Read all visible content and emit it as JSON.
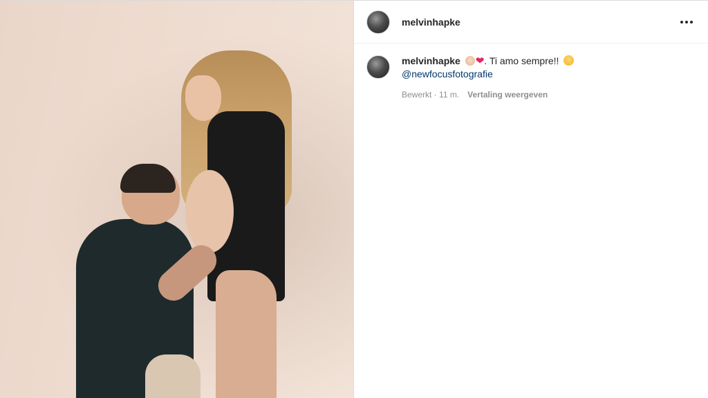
{
  "post": {
    "author": {
      "username": "melvinhapke"
    },
    "media": {
      "icon": "photo-image"
    },
    "caption": {
      "username": "melvinhapke",
      "emoji_baby": "👶🏼",
      "emoji_heart": "❤️",
      "text": ". Ti amo sempre!! ",
      "emoji_smile": "🥰",
      "mention": "@newfocusfotografie",
      "edited_label": "Bewerkt",
      "separator": " · ",
      "time": "11 m.",
      "translate_label": "Vertaling weergeven"
    }
  },
  "colors": {
    "text": "#262626",
    "link": "#00376b",
    "muted": "#8e8e8e",
    "border": "#dbdbdb"
  }
}
